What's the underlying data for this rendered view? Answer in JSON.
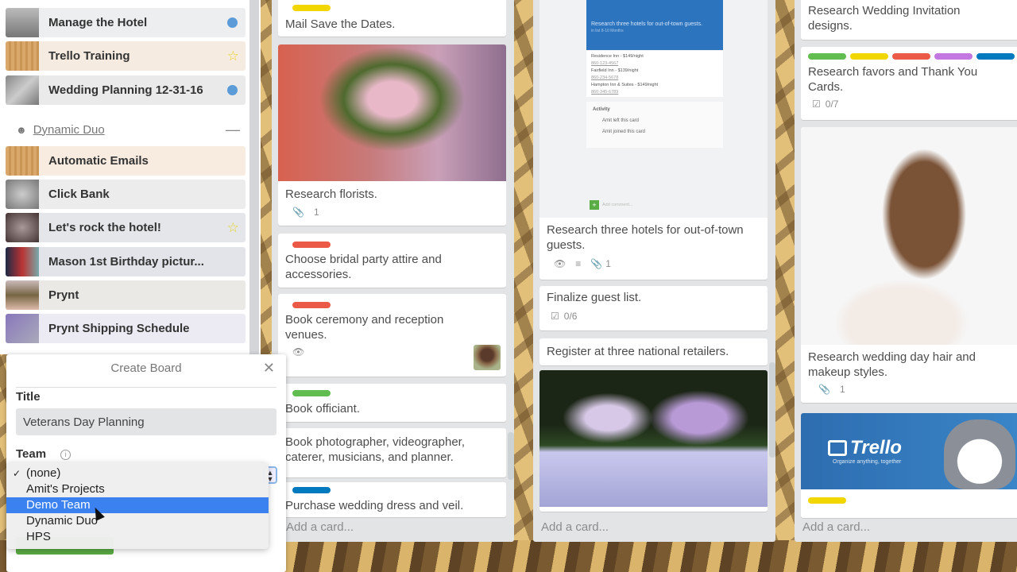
{
  "sidebar": {
    "boards_top": [
      {
        "label": "Manage the Hotel",
        "marker": "dot"
      },
      {
        "label": "Trello Training",
        "marker": "star"
      },
      {
        "label": "Wedding Planning 12-31-16",
        "marker": "dot"
      }
    ],
    "team": {
      "name": "Dynamic Duo",
      "icon": "team-icon",
      "collapse_icon": "minus-icon"
    },
    "team_boards": [
      {
        "label": "Automatic Emails",
        "marker": ""
      },
      {
        "label": "Click Bank",
        "marker": ""
      },
      {
        "label": "Let's rock the hotel!",
        "marker": "star"
      },
      {
        "label": "Mason 1st Birthday pictur...",
        "marker": ""
      },
      {
        "label": "Prynt",
        "marker": ""
      },
      {
        "label": "Prynt Shipping Schedule",
        "marker": ""
      }
    ]
  },
  "create_board": {
    "title": "Create Board",
    "close_icon": "close-icon",
    "title_label": "Title",
    "title_value": "Veterans Day Planning",
    "team_label": "Team",
    "team_options": [
      "(none)",
      "Amit's Projects",
      "Demo Team",
      "Dynamic Duo",
      "HPS"
    ],
    "team_selected": "(none)",
    "team_highlighted": "Demo Team"
  },
  "lists": [
    {
      "cards": [
        {
          "labels": [
            "#f2d600"
          ],
          "text": "Mail Save the Dates."
        },
        {
          "image": "flower-arrangement-photo",
          "text": "Research florists.",
          "attachments": "1"
        },
        {
          "labels": [
            "#eb5a46"
          ],
          "text": "Choose bridal party attire and accessories."
        },
        {
          "labels": [
            "#eb5a46"
          ],
          "text": "Book ceremony and reception venues.",
          "watching": true,
          "member": "member-avatar"
        },
        {
          "labels": [
            "#61bd4f"
          ],
          "text": "Book officiant."
        },
        {
          "text": "Book photographer, videographer, caterer, musicians, and planner."
        },
        {
          "labels": [
            "#0079bf"
          ],
          "text": "Purchase wedding dress and veil."
        }
      ],
      "add_card": "Add a card..."
    },
    {
      "cards": [
        {
          "image": "phone-screenshot",
          "text": "Research three hotels for out-of-town guests.",
          "watching": true,
          "description": true,
          "attachments": "1"
        },
        {
          "text": "Finalize guest list.",
          "checklist": "0/6"
        },
        {
          "text": "Register at three national retailers."
        },
        {
          "image": "table-centerpiece-photo"
        }
      ],
      "add_card": "Add a card..."
    },
    {
      "cards": [
        {
          "text": "Research Wedding Invitation designs."
        },
        {
          "labels": [
            "#61bd4f",
            "#f2d600",
            "#eb5a46",
            "#c377e0",
            "#0079bf"
          ],
          "text": "Research favors and Thank You Cards.",
          "checklist": "0/7"
        },
        {
          "image": "bride-hairstyle-photo",
          "text": "Research wedding day hair and makeup styles.",
          "attachments": "1"
        },
        {
          "image": "trello-banner",
          "banner_brand": "Trello",
          "banner_tagline": "Organize anything, together",
          "labels": [
            "#f2d600"
          ]
        }
      ],
      "add_card": "Add a card..."
    }
  ],
  "phone_preview": {
    "title": "Research three hotels for out-of-town guests.",
    "subtitle": "in list 8-10 Months",
    "lines": [
      "Residence Inn - $149/night",
      "860-123-4567",
      "Fairfield Inn - $139/night",
      "860-234-5678",
      "Hampton Inn & Suites - $149/night",
      "860-345-6789"
    ],
    "activity_label": "Activity",
    "activity": [
      "Amit left this card",
      "Amit joined this card"
    ],
    "comment_placeholder": "Add comment..."
  }
}
